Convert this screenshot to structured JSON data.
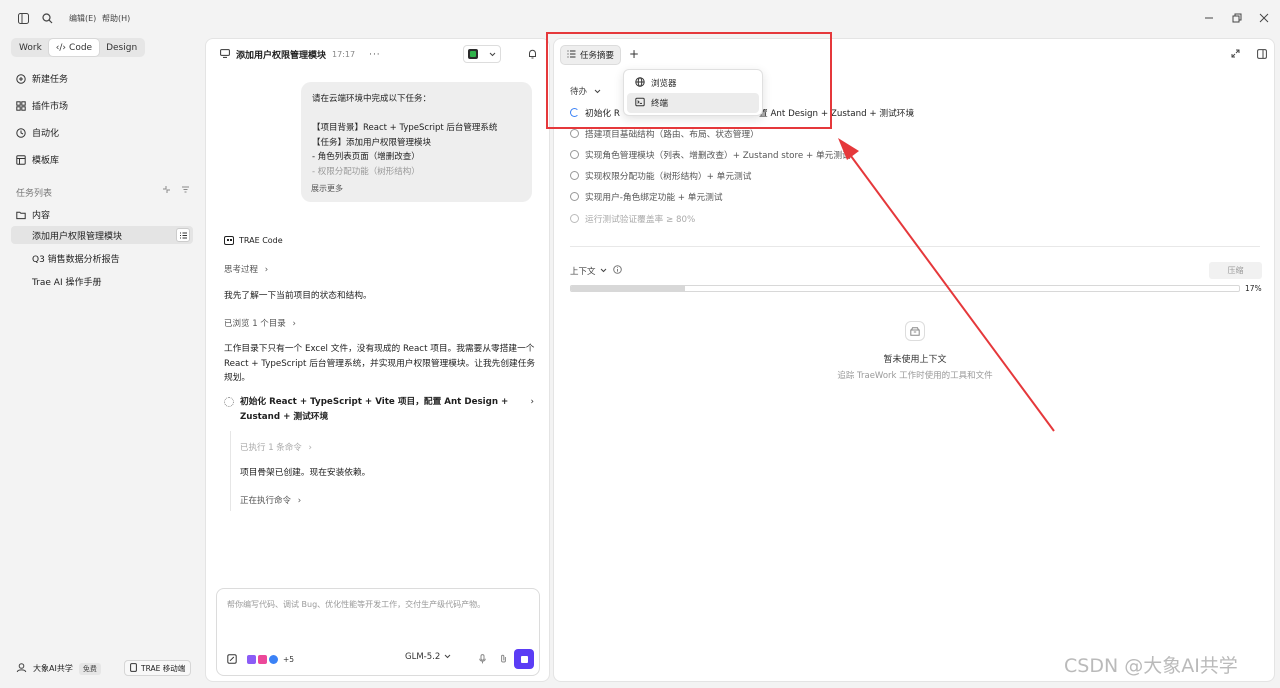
{
  "app": {
    "menu": [
      "编辑(E)",
      "帮助(H)"
    ]
  },
  "sidebar": {
    "modes": [
      "Work",
      "Code",
      "Design"
    ],
    "active_mode": "Code",
    "nav": [
      {
        "label": "新建任务",
        "icon": "plus-circle-icon"
      },
      {
        "label": "插件市场",
        "icon": "plugin-icon"
      },
      {
        "label": "自动化",
        "icon": "clock-icon"
      },
      {
        "label": "模板库",
        "icon": "template-icon"
      }
    ],
    "task_list_title": "任务列表",
    "folder": "内容",
    "tasks": [
      "添加用户权限管理模块",
      "Q3 销售数据分析报告",
      "Trae AI 操作手册"
    ],
    "user": {
      "name": "大象AI共学",
      "plan": "免费"
    },
    "mobile_label": "TRAE 移动端"
  },
  "chat": {
    "title": "添加用户权限管理模块",
    "time": "17:17",
    "user_message": {
      "line1": "请在云端环境中完成以下任务：",
      "line2": "【项目背景】React + TypeScript 后台管理系统",
      "line3": "【任务】添加用户权限管理模块",
      "line4": "- 角色列表页面（增删改查）",
      "line5": "- 权限分配功能（树形结构）"
    },
    "show_more": "展示更多",
    "assistant": "TRAE Code",
    "thinking": "思考过程",
    "msg1": "我先了解一下当前项目的状态和结构。",
    "browsed": "已浏览 1 个目录",
    "msg2": "工作目录下只有一个 Excel 文件，没有现成的 React 项目。我需要从零搭建一个 React + TypeScript 后台管理系统，并实现用户权限管理模块。让我先创建任务规划。",
    "step_title": "初始化 React + TypeScript + Vite 项目，配置 Ant Design + Zustand + 测试环境",
    "executed": "已执行 1 条命令",
    "msg3": "项目骨架已创建。现在安装依赖。",
    "running": "正在执行命令",
    "input_placeholder": "帮你编写代码、调试 Bug、优化性能等开发工作，交付生产级代码产物。",
    "plus_count": "+5",
    "model": "GLM-5.2"
  },
  "right": {
    "tab": "任务摘要",
    "add": "+",
    "todo_header": "待办",
    "todos": [
      {
        "text": "初始化 React + TypeScript + Vite 项目，配置 Ant Design + Zustand + 测试环境",
        "state": "active"
      },
      {
        "text": "搭建项目基础结构（路由、布局、状态管理）",
        "state": "pending"
      },
      {
        "text": "实现角色管理模块（列表、增删改查）+ Zustand store + 单元测试",
        "state": "pending"
      },
      {
        "text": "实现权限分配功能（树形结构）+ 单元测试",
        "state": "pending"
      },
      {
        "text": "实现用户-角色绑定功能 + 单元测试",
        "state": "pending"
      },
      {
        "text": "运行测试验证覆盖率 ≥ 80%",
        "state": "faded"
      }
    ],
    "todo_active_visible": [
      "初始化 R",
      "置 Ant Design + Zustand + 测试环境"
    ],
    "context_header": "上下文",
    "compress": "压缩",
    "progress_percent": 17,
    "progress_label": "17%",
    "empty_title": "暂未使用上下文",
    "empty_subtitle": "追踪 TraeWork 工作时使用的工具和文件"
  },
  "dropdown": {
    "items": [
      {
        "label": "浏览器",
        "icon": "globe-icon"
      },
      {
        "label": "终端",
        "icon": "terminal-icon"
      }
    ]
  },
  "colors": {
    "accent": "#5b3df5",
    "annotation": "#e5383b",
    "terminal_green": "#2fb24a"
  },
  "watermark": "CSDN @大象AI共学"
}
